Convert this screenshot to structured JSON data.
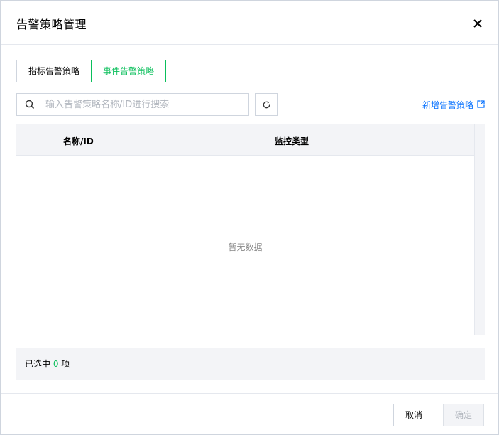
{
  "dialog": {
    "title": "告警策略管理"
  },
  "tabs": [
    {
      "label": "指标告警策略",
      "active": false
    },
    {
      "label": "事件告警策略",
      "active": true
    }
  ],
  "search": {
    "placeholder": "输入告警策略名称/ID进行搜索",
    "value": ""
  },
  "new_policy_link": "新增告警策略",
  "table": {
    "columns": [
      "名称/ID",
      "监控类型"
    ],
    "empty_text": "暂无数据"
  },
  "selection": {
    "prefix": "已选中",
    "count": "0",
    "suffix": "项"
  },
  "footer": {
    "cancel_label": "取消",
    "ok_label": "确定"
  },
  "colors": {
    "accent": "#0abf5b",
    "link": "#006eff",
    "border": "#cfd5de"
  }
}
